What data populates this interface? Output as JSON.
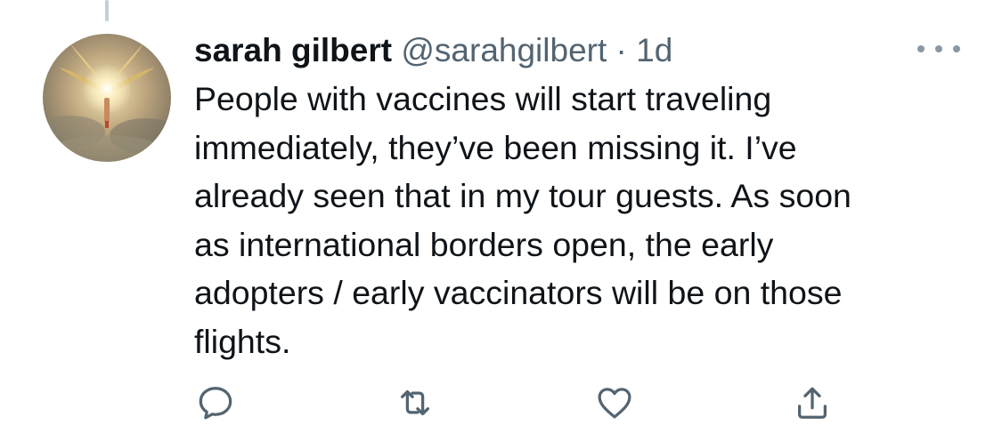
{
  "tweet": {
    "display_name": "sarah gilbert",
    "handle": "@sarahgilbert",
    "separator": "·",
    "timestamp": "1d",
    "text": "People with vaccines will start traveling\nimmediately, they’ve been missing it. I’ve\nalready seen that in my tour guests. As soon\nas international borders open, the early\nadopters / early vaccinators will be on those\nflights."
  },
  "icons": {
    "more": "more-icon",
    "reply": "reply-icon",
    "retweet": "retweet-icon",
    "like": "heart-icon",
    "share": "share-icon"
  },
  "colors": {
    "text": "#0f1419",
    "secondary": "#536471",
    "icon": "#536471",
    "thread_line": "#c4cfd6"
  }
}
